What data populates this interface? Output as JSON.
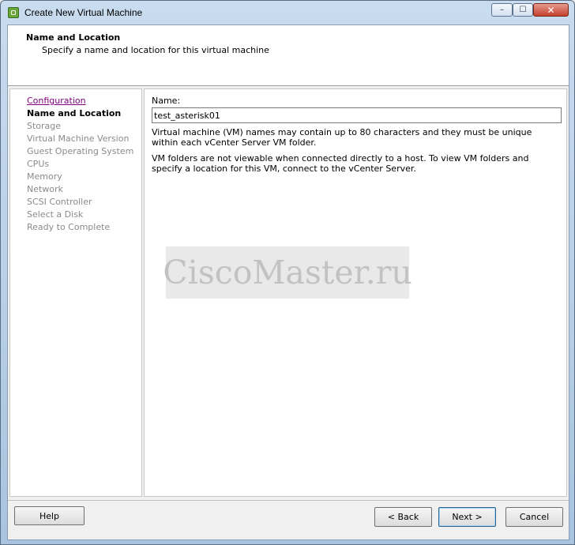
{
  "window": {
    "title": "Create New Virtual Machine",
    "controls": {
      "minimize": "–",
      "maximize": "☐",
      "close": "✕"
    }
  },
  "header": {
    "title": "Name and Location",
    "subtitle": "Specify a name and location for this virtual machine"
  },
  "nav": {
    "items": [
      {
        "label": "Configuration",
        "state": "link"
      },
      {
        "label": "Name and Location",
        "state": "current"
      },
      {
        "label": "Storage",
        "state": "disabled"
      },
      {
        "label": "Virtual Machine Version",
        "state": "disabled"
      },
      {
        "label": "Guest Operating System",
        "state": "disabled"
      },
      {
        "label": "CPUs",
        "state": "disabled"
      },
      {
        "label": "Memory",
        "state": "disabled"
      },
      {
        "label": "Network",
        "state": "disabled"
      },
      {
        "label": "SCSI Controller",
        "state": "disabled"
      },
      {
        "label": "Select a Disk",
        "state": "disabled"
      },
      {
        "label": "Ready to Complete",
        "state": "disabled"
      }
    ]
  },
  "form": {
    "name_label": "Name:",
    "name_value": "test_asterisk01",
    "info1": "Virtual machine (VM) names may contain up to 80 characters and they must be unique within each vCenter Server VM folder.",
    "info2": "VM folders are not viewable when connected directly to a host. To view VM folders and specify a location for this VM, connect to the vCenter Server."
  },
  "watermark": "CiscoMaster.ru",
  "buttons": {
    "help": "Help",
    "back": "< Back",
    "next": "Next >",
    "cancel": "Cancel"
  }
}
